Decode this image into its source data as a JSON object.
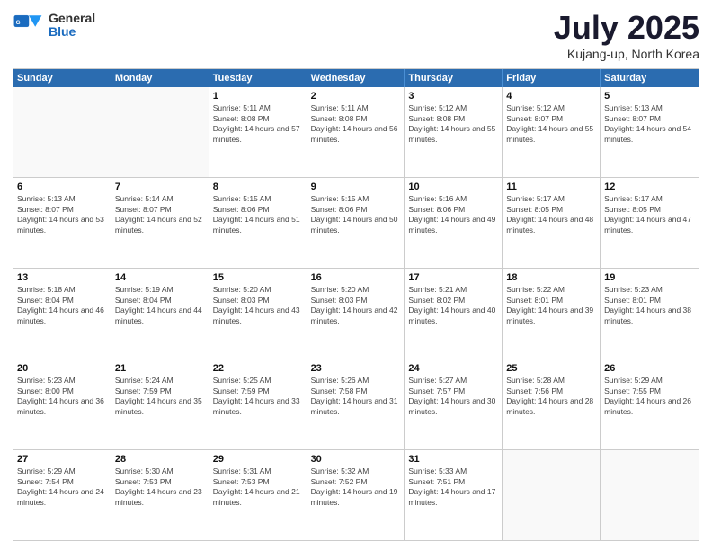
{
  "logo": {
    "general": "General",
    "blue": "Blue"
  },
  "title": "July 2025",
  "location": "Kujang-up, North Korea",
  "days_of_week": [
    "Sunday",
    "Monday",
    "Tuesday",
    "Wednesday",
    "Thursday",
    "Friday",
    "Saturday"
  ],
  "weeks": [
    [
      {
        "day": "",
        "sunrise": "",
        "sunset": "",
        "daylight": ""
      },
      {
        "day": "",
        "sunrise": "",
        "sunset": "",
        "daylight": ""
      },
      {
        "day": "1",
        "sunrise": "Sunrise: 5:11 AM",
        "sunset": "Sunset: 8:08 PM",
        "daylight": "Daylight: 14 hours and 57 minutes."
      },
      {
        "day": "2",
        "sunrise": "Sunrise: 5:11 AM",
        "sunset": "Sunset: 8:08 PM",
        "daylight": "Daylight: 14 hours and 56 minutes."
      },
      {
        "day": "3",
        "sunrise": "Sunrise: 5:12 AM",
        "sunset": "Sunset: 8:08 PM",
        "daylight": "Daylight: 14 hours and 55 minutes."
      },
      {
        "day": "4",
        "sunrise": "Sunrise: 5:12 AM",
        "sunset": "Sunset: 8:07 PM",
        "daylight": "Daylight: 14 hours and 55 minutes."
      },
      {
        "day": "5",
        "sunrise": "Sunrise: 5:13 AM",
        "sunset": "Sunset: 8:07 PM",
        "daylight": "Daylight: 14 hours and 54 minutes."
      }
    ],
    [
      {
        "day": "6",
        "sunrise": "Sunrise: 5:13 AM",
        "sunset": "Sunset: 8:07 PM",
        "daylight": "Daylight: 14 hours and 53 minutes."
      },
      {
        "day": "7",
        "sunrise": "Sunrise: 5:14 AM",
        "sunset": "Sunset: 8:07 PM",
        "daylight": "Daylight: 14 hours and 52 minutes."
      },
      {
        "day": "8",
        "sunrise": "Sunrise: 5:15 AM",
        "sunset": "Sunset: 8:06 PM",
        "daylight": "Daylight: 14 hours and 51 minutes."
      },
      {
        "day": "9",
        "sunrise": "Sunrise: 5:15 AM",
        "sunset": "Sunset: 8:06 PM",
        "daylight": "Daylight: 14 hours and 50 minutes."
      },
      {
        "day": "10",
        "sunrise": "Sunrise: 5:16 AM",
        "sunset": "Sunset: 8:06 PM",
        "daylight": "Daylight: 14 hours and 49 minutes."
      },
      {
        "day": "11",
        "sunrise": "Sunrise: 5:17 AM",
        "sunset": "Sunset: 8:05 PM",
        "daylight": "Daylight: 14 hours and 48 minutes."
      },
      {
        "day": "12",
        "sunrise": "Sunrise: 5:17 AM",
        "sunset": "Sunset: 8:05 PM",
        "daylight": "Daylight: 14 hours and 47 minutes."
      }
    ],
    [
      {
        "day": "13",
        "sunrise": "Sunrise: 5:18 AM",
        "sunset": "Sunset: 8:04 PM",
        "daylight": "Daylight: 14 hours and 46 minutes."
      },
      {
        "day": "14",
        "sunrise": "Sunrise: 5:19 AM",
        "sunset": "Sunset: 8:04 PM",
        "daylight": "Daylight: 14 hours and 44 minutes."
      },
      {
        "day": "15",
        "sunrise": "Sunrise: 5:20 AM",
        "sunset": "Sunset: 8:03 PM",
        "daylight": "Daylight: 14 hours and 43 minutes."
      },
      {
        "day": "16",
        "sunrise": "Sunrise: 5:20 AM",
        "sunset": "Sunset: 8:03 PM",
        "daylight": "Daylight: 14 hours and 42 minutes."
      },
      {
        "day": "17",
        "sunrise": "Sunrise: 5:21 AM",
        "sunset": "Sunset: 8:02 PM",
        "daylight": "Daylight: 14 hours and 40 minutes."
      },
      {
        "day": "18",
        "sunrise": "Sunrise: 5:22 AM",
        "sunset": "Sunset: 8:01 PM",
        "daylight": "Daylight: 14 hours and 39 minutes."
      },
      {
        "day": "19",
        "sunrise": "Sunrise: 5:23 AM",
        "sunset": "Sunset: 8:01 PM",
        "daylight": "Daylight: 14 hours and 38 minutes."
      }
    ],
    [
      {
        "day": "20",
        "sunrise": "Sunrise: 5:23 AM",
        "sunset": "Sunset: 8:00 PM",
        "daylight": "Daylight: 14 hours and 36 minutes."
      },
      {
        "day": "21",
        "sunrise": "Sunrise: 5:24 AM",
        "sunset": "Sunset: 7:59 PM",
        "daylight": "Daylight: 14 hours and 35 minutes."
      },
      {
        "day": "22",
        "sunrise": "Sunrise: 5:25 AM",
        "sunset": "Sunset: 7:59 PM",
        "daylight": "Daylight: 14 hours and 33 minutes."
      },
      {
        "day": "23",
        "sunrise": "Sunrise: 5:26 AM",
        "sunset": "Sunset: 7:58 PM",
        "daylight": "Daylight: 14 hours and 31 minutes."
      },
      {
        "day": "24",
        "sunrise": "Sunrise: 5:27 AM",
        "sunset": "Sunset: 7:57 PM",
        "daylight": "Daylight: 14 hours and 30 minutes."
      },
      {
        "day": "25",
        "sunrise": "Sunrise: 5:28 AM",
        "sunset": "Sunset: 7:56 PM",
        "daylight": "Daylight: 14 hours and 28 minutes."
      },
      {
        "day": "26",
        "sunrise": "Sunrise: 5:29 AM",
        "sunset": "Sunset: 7:55 PM",
        "daylight": "Daylight: 14 hours and 26 minutes."
      }
    ],
    [
      {
        "day": "27",
        "sunrise": "Sunrise: 5:29 AM",
        "sunset": "Sunset: 7:54 PM",
        "daylight": "Daylight: 14 hours and 24 minutes."
      },
      {
        "day": "28",
        "sunrise": "Sunrise: 5:30 AM",
        "sunset": "Sunset: 7:53 PM",
        "daylight": "Daylight: 14 hours and 23 minutes."
      },
      {
        "day": "29",
        "sunrise": "Sunrise: 5:31 AM",
        "sunset": "Sunset: 7:53 PM",
        "daylight": "Daylight: 14 hours and 21 minutes."
      },
      {
        "day": "30",
        "sunrise": "Sunrise: 5:32 AM",
        "sunset": "Sunset: 7:52 PM",
        "daylight": "Daylight: 14 hours and 19 minutes."
      },
      {
        "day": "31",
        "sunrise": "Sunrise: 5:33 AM",
        "sunset": "Sunset: 7:51 PM",
        "daylight": "Daylight: 14 hours and 17 minutes."
      },
      {
        "day": "",
        "sunrise": "",
        "sunset": "",
        "daylight": ""
      },
      {
        "day": "",
        "sunrise": "",
        "sunset": "",
        "daylight": ""
      }
    ]
  ]
}
